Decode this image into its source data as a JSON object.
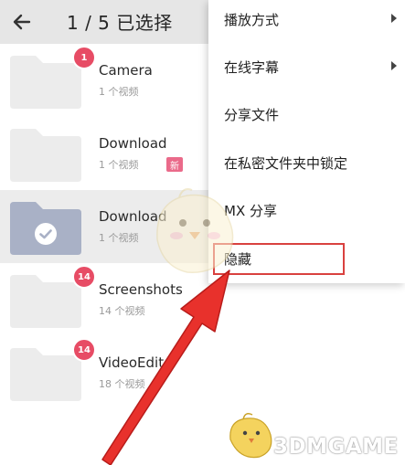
{
  "header": {
    "title": "1 / 5 已选择",
    "back_icon": "arrow-left-icon"
  },
  "folders": [
    {
      "name": "Camera",
      "sub": "1 个视频",
      "badge": "1",
      "selected": false
    },
    {
      "name": "Download",
      "sub": "1 个视频",
      "badge": "",
      "selected": false
    },
    {
      "name": "Download",
      "sub": "1 个视频",
      "badge": "",
      "selected": true
    },
    {
      "name": "Screenshots",
      "sub": "14 个视频",
      "badge": "14",
      "selected": false
    },
    {
      "name": "VideoEditor",
      "sub": "18 个视频",
      "badge": "14",
      "selected": false
    }
  ],
  "menu": {
    "items": [
      {
        "label": "播放方式",
        "has_submenu": true
      },
      {
        "label": "在线字幕",
        "has_submenu": true
      },
      {
        "label": "分享文件",
        "has_submenu": false
      },
      {
        "label": "在私密文件夹中锁定",
        "has_submenu": false,
        "tag": "新"
      },
      {
        "label": "MX 分享",
        "has_submenu": false
      },
      {
        "label": "隐藏",
        "has_submenu": false,
        "highlighted": true
      }
    ]
  },
  "watermark": {
    "text": "3DMGAME"
  },
  "colors": {
    "topbar_bg": "#e6e6e6",
    "folder_fill": "#ececec",
    "folder_selected_fill": "#a9b1c6",
    "badge": "#e74c65",
    "new_tag": "#ea6a8a",
    "highlight": "#d9413f",
    "arrow": "#e8312c"
  }
}
